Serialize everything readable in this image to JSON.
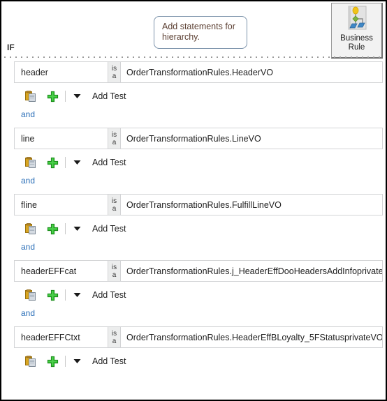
{
  "callout": {
    "text": "Add statements for hierarchy."
  },
  "business_rule_button": {
    "label_line1": "Business",
    "label_line2": "Rule",
    "icon": "business-rule-hierarchy-icon",
    "colors": {
      "node_top": "#f0c419",
      "node_mid": "#7cb342",
      "node_leaf": "#3f87c6",
      "connector": "#8a8a8a",
      "panel": "#e3e3e3"
    }
  },
  "if_section": {
    "label": "IF"
  },
  "toolbar": {
    "copy_icon": "copy-clipboard-icon",
    "add_icon": "add-plus-icon",
    "caret_icon": "chevron-down-icon",
    "add_test_label": "Add Test"
  },
  "connector_label": "and",
  "colors": {
    "row_bg": "#eceded",
    "row_border": "#d3d4d6",
    "link": "#2b6fb8",
    "callout_border": "#7c93ab",
    "callout_text": "#5c4033"
  },
  "isa": {
    "line1": "is",
    "line2": "a"
  },
  "rules": [
    {
      "name": "header",
      "type": "OrderTransformationRules.HeaderVO",
      "connector": "and",
      "has_connector": true
    },
    {
      "name": "line",
      "type": "OrderTransformationRules.LineVO",
      "connector": "and",
      "has_connector": true
    },
    {
      "name": "fline",
      "type": "OrderTransformationRules.FulfillLineVO",
      "connector": "and",
      "has_connector": true
    },
    {
      "name": "headerEFFcat",
      "type": "OrderTransformationRules.j_HeaderEffDooHeadersAddInfoprivateVO",
      "connector": "and",
      "has_connector": true
    },
    {
      "name": "headerEFFCtxt",
      "type": "OrderTransformationRules.HeaderEffBLoyalty_5FStatusprivateVO",
      "connector": "",
      "has_connector": false
    }
  ]
}
